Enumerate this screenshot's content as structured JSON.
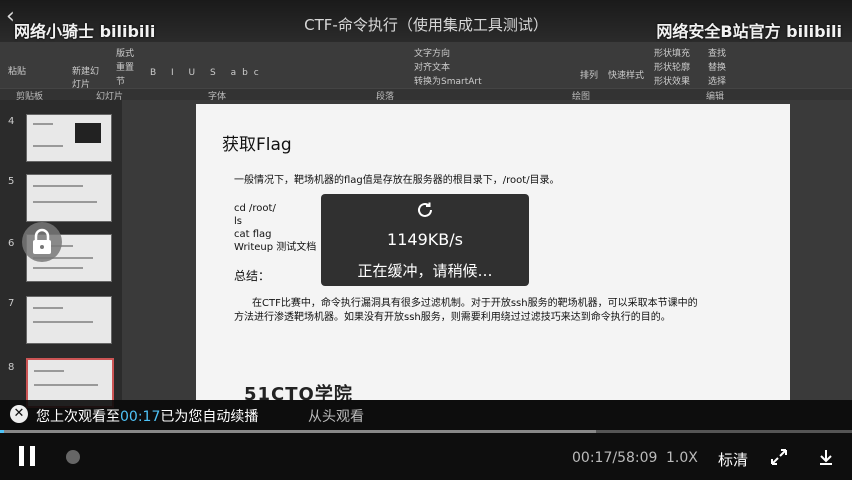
{
  "watermark": {
    "left": "网络小骑士 bilibili",
    "right": "网络安全B站官方 bilibili"
  },
  "video_title": "CTF-命令执行（使用集成工具测试）",
  "ribbon": {
    "groups": [
      "剪贴板",
      "幻灯片",
      "字体",
      "段落",
      "绘图",
      "编辑"
    ],
    "items": [
      "粘贴",
      "新建幻灯片",
      "版式",
      "重置",
      "节",
      "文字方向",
      "对齐文本",
      "转换为SmartArt",
      "排列",
      "快速样式",
      "形状填充",
      "形状轮廓",
      "形状效果",
      "查找",
      "替换",
      "选择"
    ]
  },
  "thumbnails": {
    "numbers": [
      "4",
      "5",
      "6",
      "7",
      "8"
    ]
  },
  "slide": {
    "title": "获取Flag",
    "line1": "一般情况下，靶场机器的flag值是存放在服务器的根目录下，/root/目录。",
    "cmd1": "cd /root/",
    "cmd2": "ls",
    "cmd3": "cat flag",
    "cmd4": "Writeup 测试文档",
    "summary_label": "总结：",
    "summary_1": "在CTF比赛中，命令执行漏洞具有很多过滤机制。对于开放ssh服务的靶场机器，可以采取本节课中的",
    "summary_2": "方法进行渗透靶场机器。如果没有开放ssh服务，则需要利用绕过过滤技巧来达到命令执行的目的。",
    "logo": "51CTO学院"
  },
  "buffering": {
    "speed": "1149KB/s",
    "message": "正在缓冲，请稍候…"
  },
  "resume": {
    "prefix": "您上次观看至",
    "time": "00:17",
    "suffix": "已为您自动续播",
    "replay": "从头观看"
  },
  "controls": {
    "time": "00:17/58:09",
    "rate": "1.0X",
    "quality": "标清",
    "progress": 0.005,
    "buffered": 0.7
  },
  "colors": {
    "accent": "#4fc3f7"
  }
}
